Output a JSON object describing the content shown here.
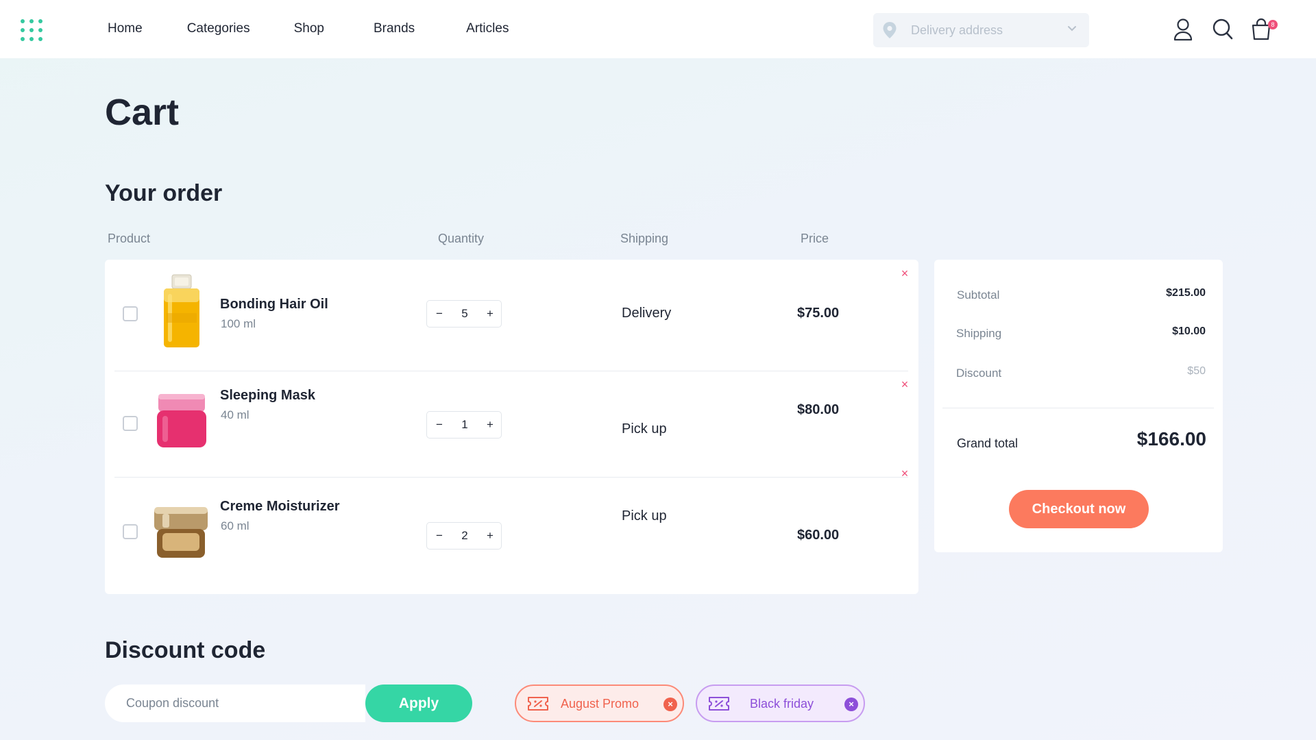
{
  "nav": {
    "items": [
      "Home",
      "Categories",
      "Shop",
      "Brands",
      "Articles"
    ]
  },
  "header": {
    "address_placeholder": "Delivery address",
    "cart_badge": "8",
    "icons": [
      "location-pin-icon",
      "chevron-down-icon",
      "user-icon",
      "search-icon",
      "shopping-bag-icon"
    ]
  },
  "page": {
    "title": "Cart",
    "order_title": "Your order"
  },
  "columns": {
    "product": "Product",
    "quantity": "Quantity",
    "shipping": "Shipping",
    "price": "Price"
  },
  "items": [
    {
      "name": "Bonding Hair Oil",
      "size": "100 ml",
      "qty": "5",
      "shipping": "Delivery",
      "price": "$75.00",
      "thumb": "hair-oil-bottle"
    },
    {
      "name": "Sleeping Mask",
      "size": "40 ml",
      "qty": "1",
      "shipping": "Pick up",
      "price": "$80.00",
      "thumb": "pink-jar"
    },
    {
      "name": "Creme Moisturizer",
      "size": "60 ml",
      "qty": "2",
      "shipping": "Pick up",
      "price": "$60.00",
      "thumb": "gold-jar"
    }
  ],
  "stepper": {
    "minus": "−",
    "plus": "+"
  },
  "remove_symbol": "×",
  "summary": {
    "subtotal_label": "Subtotal",
    "subtotal_value": "$215.00",
    "shipping_label": "Shipping",
    "shipping_value": "$10.00",
    "discount_label": "Discount",
    "discount_value": "$50",
    "grand_label": "Grand total",
    "grand_value": "$166.00",
    "checkout_label": "Checkout now"
  },
  "discount": {
    "title": "Discount code",
    "placeholder": "Coupon discount",
    "apply_label": "Apply",
    "promos": [
      "August Promo",
      "Black friday"
    ]
  },
  "colors": {
    "accent_green": "#35d6a5",
    "accent_coral": "#fc7a5e",
    "remove_pink": "#ef4f7a",
    "promo_orange": "#f0624d",
    "promo_purple": "#8d4fd9"
  }
}
